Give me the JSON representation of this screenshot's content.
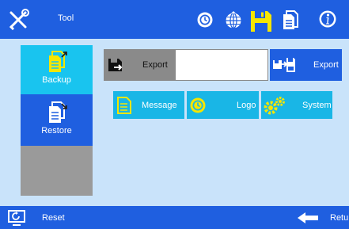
{
  "header": {
    "title": "Tool",
    "icons": [
      "tools-icon",
      "clock-icon",
      "network-globe-icon",
      "save-disk-icon",
      "document-icon",
      "info-icon"
    ]
  },
  "sidebar": {
    "items": [
      {
        "label": "Backup",
        "icon": "backup-document-icon",
        "active": true
      },
      {
        "label": "Restore",
        "icon": "restore-document-icon",
        "active": false
      }
    ]
  },
  "export_row": {
    "left_label": "Export",
    "input_value": "",
    "right_label": "Export"
  },
  "categories": [
    {
      "label": "Message",
      "icon": "message-document-icon"
    },
    {
      "label": "Logo",
      "icon": "logo-clock-icon"
    },
    {
      "label": "System",
      "icon": "system-gears-icon"
    }
  ],
  "footer": {
    "reset_label": "Reset",
    "return_label": "Retu"
  },
  "colors": {
    "bar_blue": "#1f5fe0",
    "panel_bg": "#c9e3fa",
    "accent_yellow": "#f5e600",
    "cyan": "#19b6e6",
    "sidebar_active": "#19c4ef",
    "sidebar_empty": "#9a9a9a",
    "export_gray": "#8a8a8a"
  }
}
